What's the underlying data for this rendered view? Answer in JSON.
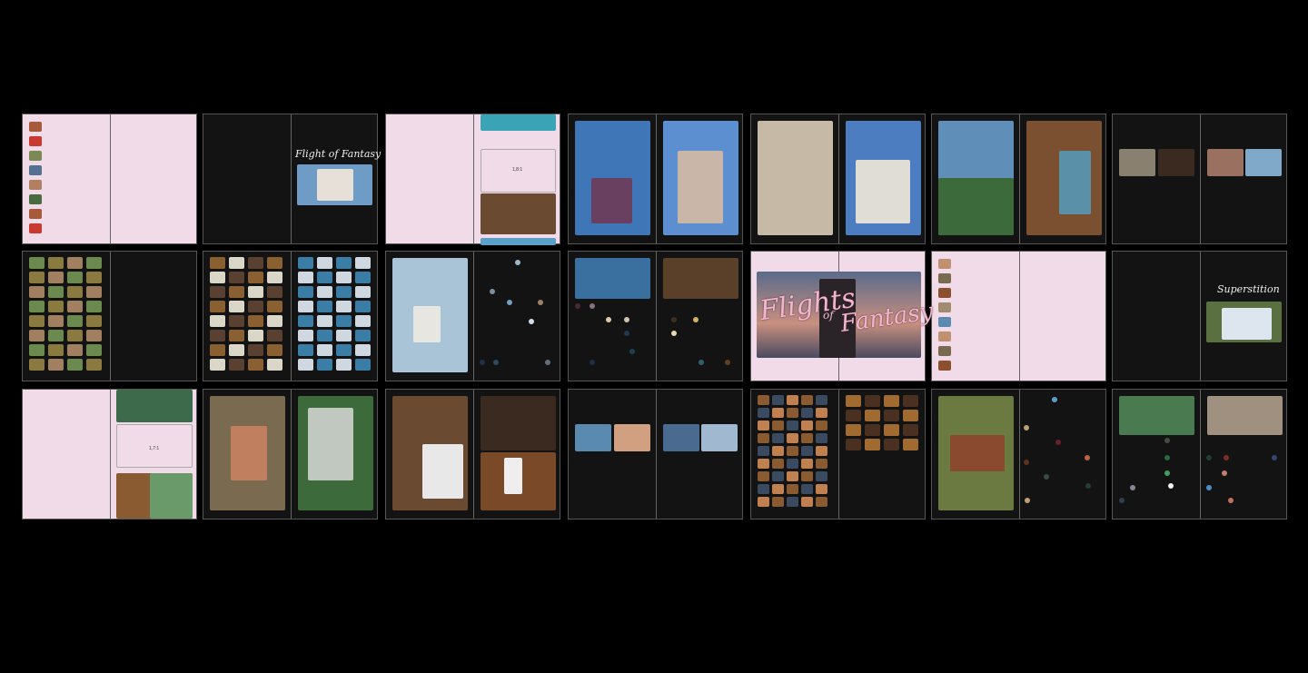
{
  "titles": {
    "flight_of_fantasy": "Flight of Fantasy",
    "flights": "Flights",
    "of": "of",
    "fantasy": "Fantasy",
    "superstition": "Superstition"
  },
  "ratios": {
    "first": "1,8:1",
    "second": "1,7:1"
  },
  "colors": {
    "background": "#000000",
    "pink_page": "#f1dbe8",
    "dark_page": "#141313",
    "accent_pink": "#e7a7c4"
  }
}
